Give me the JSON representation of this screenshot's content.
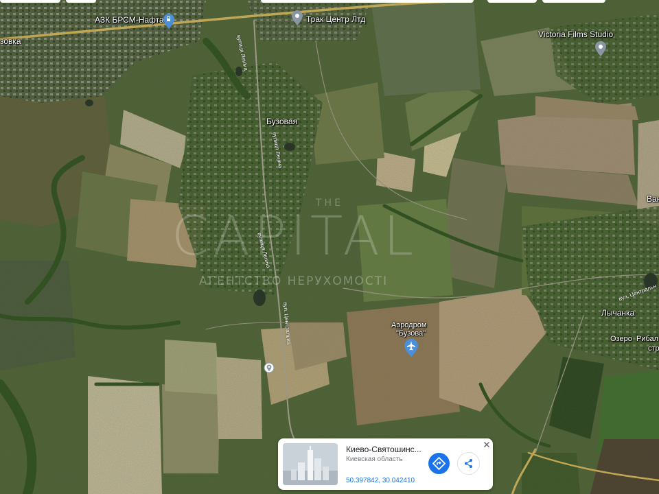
{
  "map": {
    "places": [
      {
        "id": "azk",
        "label": "АЗК БРСМ-Нафта"
      },
      {
        "id": "truck",
        "label": "Трак Центр Лтд"
      },
      {
        "id": "victoria",
        "label": "Victoria Films Studio"
      },
      {
        "id": "buzovaya",
        "label": "Бузовая"
      },
      {
        "id": "lychanka",
        "label": "Лычанка"
      },
      {
        "id": "airfield1",
        "label": "Аэродром"
      },
      {
        "id": "airfield2",
        "label": "\"Бузова\""
      },
      {
        "id": "edge_left",
        "label": "зовка"
      },
      {
        "id": "edge_right1",
        "label": "Ван"
      },
      {
        "id": "lake1",
        "label": "Озеро"
      },
      {
        "id": "lake2",
        "label": "Рибал"
      },
      {
        "id": "lake3",
        "label": "стр"
      }
    ],
    "streets": [
      {
        "id": "lenina1",
        "label": "вулиця Леніна"
      },
      {
        "id": "lenina2",
        "label": "вулиця Леніна"
      },
      {
        "id": "lenina3",
        "label": "вулиця Леніна"
      },
      {
        "id": "centr1",
        "label": "вул. Центральна"
      },
      {
        "id": "centr2",
        "label": "вул. Центральн"
      }
    ],
    "pins": [
      {
        "id": "azk-pin",
        "icon": "fuel-icon"
      },
      {
        "id": "truck-pin",
        "icon": "place-icon"
      },
      {
        "id": "victoria-pin",
        "icon": "place-icon"
      },
      {
        "id": "airfield-pin",
        "icon": "airplane-icon"
      },
      {
        "id": "dropped-pin",
        "icon": "place-icon"
      }
    ],
    "colors": {
      "road": "#d4b35a",
      "pin_blue": "#4a8fd8",
      "pin_gray": "#8a96a3"
    }
  },
  "watermark": {
    "the": "THE",
    "brand": "CAPITAL",
    "tagline": "АГЕНТСТВО НЕРУХОМОСТІ"
  },
  "info_card": {
    "title": "Киево-Святошинс...",
    "region": "Киевская область",
    "coords": "50.397842, 30.042410",
    "directions_icon": "directions-icon",
    "share_icon": "share-icon",
    "close_icon": "close-icon",
    "accent": "#1a73e8"
  }
}
